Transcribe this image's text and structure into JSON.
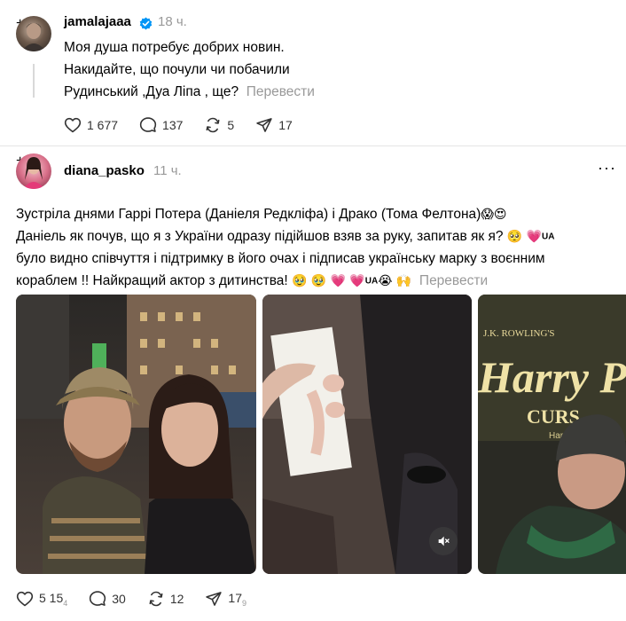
{
  "post1": {
    "username": "jamalajaaa",
    "time": "18 ч.",
    "lines": [
      "Моя душа потребує добрих новин.",
      "Накидайте, що почули чи побачили",
      "Рудинський ,Дуа Ліпа , ще?"
    ],
    "translate": "Перевести",
    "likes": "1 677",
    "comments": "137",
    "reposts": "5",
    "shares": "17"
  },
  "post2": {
    "username": "diana_pasko",
    "time": "11 ч.",
    "more": "···",
    "line1": "Зустріла днями Гаррі Потера (Даніеля Редкліфа) і Драко (Тома Фелтона)",
    "line2": "Даніель як почув, що я з України одразу підійшов взяв за руку, запитав як я?",
    "line3": "було видно співчуття і підтримку в його очах і підписав українську марку з воєнним",
    "line4": "кораблем !! Найкращий актор з дитинства!",
    "ua": "UA",
    "translate": "Перевести",
    "sign_brand": "J.K. ROWLING'S",
    "sign_title": "Harry P",
    "sign_sub": "CURS",
    "sign_sub2": "Harry",
    "likes": "5 15",
    "likes_tail": "4",
    "comments": "30",
    "reposts": "12",
    "shares": "17",
    "shares_tail": "9"
  },
  "colors": {
    "muted": "#999999",
    "verified": "#0095f6",
    "heart": "#e0245e"
  },
  "icons": [
    "verified-icon",
    "heart-icon",
    "comment-icon",
    "repost-icon",
    "share-icon",
    "mute-icon",
    "more-icon"
  ]
}
